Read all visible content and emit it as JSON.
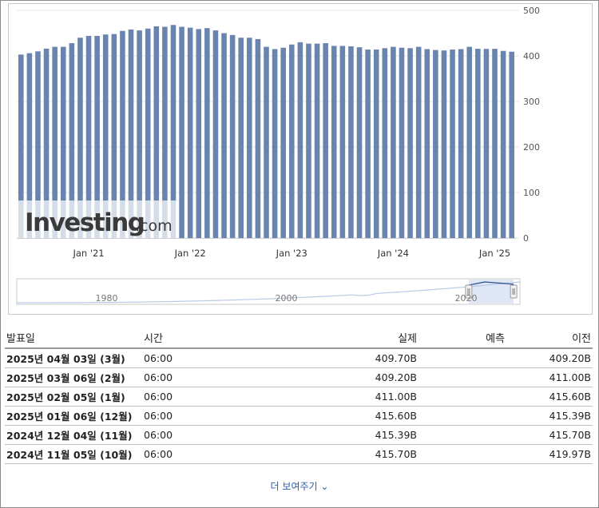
{
  "chart_data": {
    "type": "bar",
    "x": [
      "2020-05",
      "2020-06",
      "2020-07",
      "2020-08",
      "2020-09",
      "2020-10",
      "2020-11",
      "2020-12",
      "2021-01",
      "2021-02",
      "2021-03",
      "2021-04",
      "2021-05",
      "2021-06",
      "2021-07",
      "2021-08",
      "2021-09",
      "2021-10",
      "2021-11",
      "2021-12",
      "2022-01",
      "2022-02",
      "2022-03",
      "2022-04",
      "2022-05",
      "2022-06",
      "2022-07",
      "2022-08",
      "2022-09",
      "2022-10",
      "2022-11",
      "2022-12",
      "2023-01",
      "2023-02",
      "2023-03",
      "2023-04",
      "2023-05",
      "2023-06",
      "2023-07",
      "2023-08",
      "2023-09",
      "2023-10",
      "2023-11",
      "2023-12",
      "2024-01",
      "2024-02",
      "2024-03",
      "2024-04",
      "2024-05",
      "2024-06",
      "2024-07",
      "2024-08",
      "2024-09",
      "2024-10",
      "2024-11",
      "2024-12",
      "2025-01",
      "2025-02",
      "2025-03"
    ],
    "values": [
      403,
      406,
      410,
      416,
      420,
      420,
      428,
      440,
      444,
      444,
      447,
      448,
      455,
      458,
      456,
      460,
      465,
      464,
      468,
      464,
      462,
      459,
      461,
      456,
      450,
      446,
      440,
      440,
      437,
      420,
      415,
      418,
      425,
      430,
      427,
      427,
      428,
      422,
      422,
      421,
      419,
      414,
      414,
      417,
      420,
      418,
      417,
      420,
      415,
      413,
      412,
      414,
      415,
      420,
      415.7,
      415.39,
      415.6,
      411.0,
      409.2
    ],
    "ylim": [
      0,
      500
    ],
    "yticks": [
      0,
      100,
      200,
      300,
      400,
      500
    ],
    "xticks": [
      {
        "label": "Jan '21",
        "x": "2021-01"
      },
      {
        "label": "Jan '22",
        "x": "2022-01"
      },
      {
        "label": "Jan '23",
        "x": "2023-01"
      },
      {
        "label": "Jan '24",
        "x": "2024-01"
      },
      {
        "label": "Jan '25",
        "x": "2025-01"
      }
    ],
    "bar_color": "#6a84b0",
    "navigator": {
      "labels": [
        "1980",
        "2000",
        "2020"
      ],
      "range": [
        1970,
        2026
      ],
      "selected": [
        2020.3,
        2025.3
      ],
      "line_color": "#b9c9e6",
      "fill_color": "#d9e3f4"
    },
    "watermark": "Investing.com"
  },
  "table": {
    "headers": {
      "date": "발표일",
      "time": "시간",
      "actual": "실제",
      "forecast": "예측",
      "previous": "이전"
    },
    "rows": [
      {
        "date": "2025년 04월 03일 (3월)",
        "time": "06:00",
        "actual": "409.70B",
        "forecast": "",
        "previous": "409.20B"
      },
      {
        "date": "2025년 03월 06일 (2월)",
        "time": "06:00",
        "actual": "409.20B",
        "forecast": "",
        "previous": "411.00B"
      },
      {
        "date": "2025년 02월 05일 (1월)",
        "time": "06:00",
        "actual": "411.00B",
        "forecast": "",
        "previous": "415.60B"
      },
      {
        "date": "2025년 01월 06일 (12월)",
        "time": "06:00",
        "actual": "415.60B",
        "forecast": "",
        "previous": "415.39B"
      },
      {
        "date": "2024년 12월 04일 (11월)",
        "time": "06:00",
        "actual": "415.39B",
        "forecast": "",
        "previous": "415.70B"
      },
      {
        "date": "2024년 11월 05일 (10월)",
        "time": "06:00",
        "actual": "415.70B",
        "forecast": "",
        "previous": "419.97B"
      }
    ]
  },
  "more_label": "더 보여주기 ⌄"
}
